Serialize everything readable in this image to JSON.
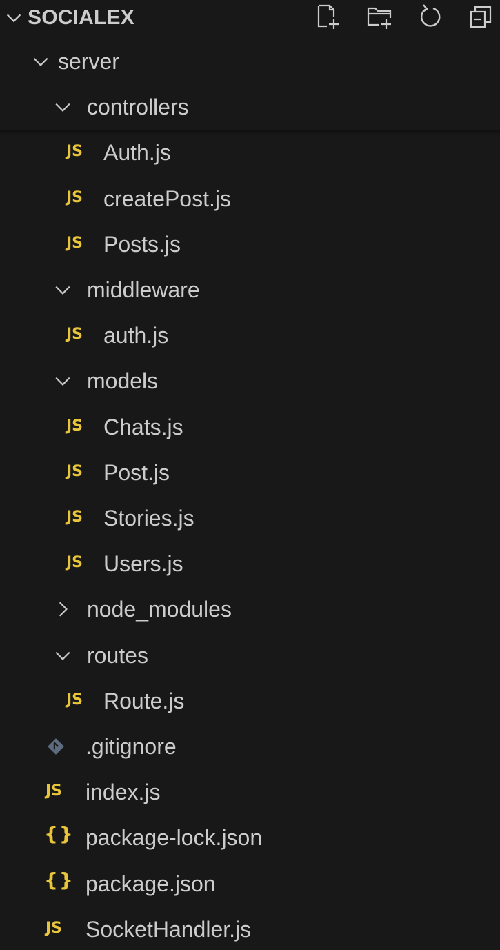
{
  "explorer": {
    "title": "SOCIALEX",
    "title_chevron_icon": "chevron-down-icon",
    "actions": [
      {
        "name": "new-file-button",
        "icon": "new-file-icon"
      },
      {
        "name": "new-folder-button",
        "icon": "new-folder-icon"
      },
      {
        "name": "refresh-button",
        "icon": "refresh-icon"
      },
      {
        "name": "collapse-all-button",
        "icon": "collapse-all-icon"
      }
    ]
  },
  "tree": [
    {
      "label": "server",
      "type": "folder",
      "expanded": true,
      "depth": 1
    },
    {
      "label": "controllers",
      "type": "folder",
      "expanded": true,
      "depth": 2
    },
    {
      "label": "Auth.js",
      "type": "js",
      "depth": 3
    },
    {
      "label": "createPost.js",
      "type": "js",
      "depth": 3
    },
    {
      "label": "Posts.js",
      "type": "js",
      "depth": 3
    },
    {
      "label": "middleware",
      "type": "folder",
      "expanded": true,
      "depth": 2
    },
    {
      "label": "auth.js",
      "type": "js",
      "depth": 3
    },
    {
      "label": "models",
      "type": "folder",
      "expanded": true,
      "depth": 2
    },
    {
      "label": "Chats.js",
      "type": "js",
      "depth": 3
    },
    {
      "label": "Post.js",
      "type": "js",
      "depth": 3
    },
    {
      "label": "Stories.js",
      "type": "js",
      "depth": 3
    },
    {
      "label": "Users.js",
      "type": "js",
      "depth": 3
    },
    {
      "label": "node_modules",
      "type": "folder",
      "expanded": false,
      "depth": 2
    },
    {
      "label": "routes",
      "type": "folder",
      "expanded": true,
      "depth": 2
    },
    {
      "label": "Route.js",
      "type": "js",
      "depth": 3
    },
    {
      "label": ".gitignore",
      "type": "git",
      "depth": 2
    },
    {
      "label": "index.js",
      "type": "js",
      "depth": 2
    },
    {
      "label": "package-lock.json",
      "type": "json",
      "depth": 2
    },
    {
      "label": "package.json",
      "type": "json",
      "depth": 2
    },
    {
      "label": "SocketHandler.js",
      "type": "js",
      "depth": 2
    }
  ],
  "icons": {
    "js_glyph": "JS",
    "json_glyph": "{}"
  },
  "colors": {
    "background": "#181818",
    "text": "#cccccc",
    "js_icon": "#e8c53a",
    "json_icon": "#e8c53a",
    "git_icon": "#5c6b80"
  }
}
